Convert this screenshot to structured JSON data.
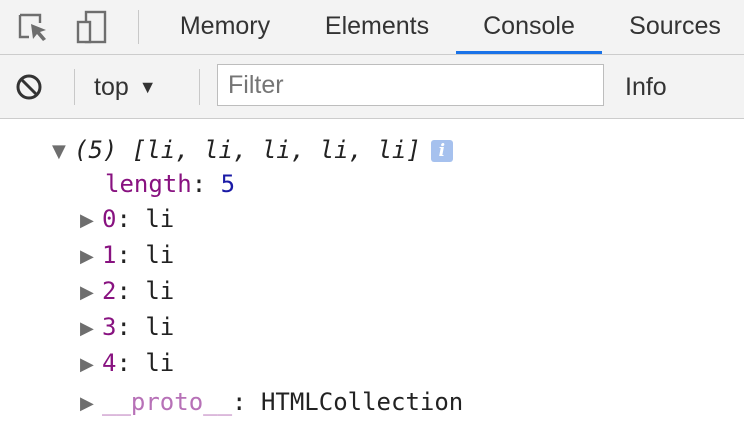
{
  "tabs": [
    {
      "label": "Memory",
      "active": false
    },
    {
      "label": "Elements",
      "active": false
    },
    {
      "label": "Console",
      "active": true
    },
    {
      "label": "Sources",
      "active": false
    }
  ],
  "toolbar": {
    "context": "top",
    "filter_placeholder": "Filter",
    "level": "Info"
  },
  "console": {
    "summary": {
      "count": "(5)",
      "items": "[li, li, li, li, li]",
      "info_badge": "i"
    },
    "length": {
      "key": "length",
      "value": "5"
    },
    "items": [
      {
        "key": "0",
        "value": "li"
      },
      {
        "key": "1",
        "value": "li"
      },
      {
        "key": "2",
        "value": "li"
      },
      {
        "key": "3",
        "value": "li"
      },
      {
        "key": "4",
        "value": "li"
      }
    ],
    "proto": {
      "key": "__proto__",
      "value": "HTMLCollection"
    }
  },
  "colors": {
    "accent": "#1a73e8",
    "key": "#881280",
    "number": "#1a1aa6",
    "proto": "#b771b7"
  },
  "icons": {
    "inspect": "inspect-element-icon",
    "device": "device-toolbar-icon",
    "clear": "clear-console-icon",
    "expand": "triangle-right-icon",
    "collapse": "triangle-down-icon"
  }
}
